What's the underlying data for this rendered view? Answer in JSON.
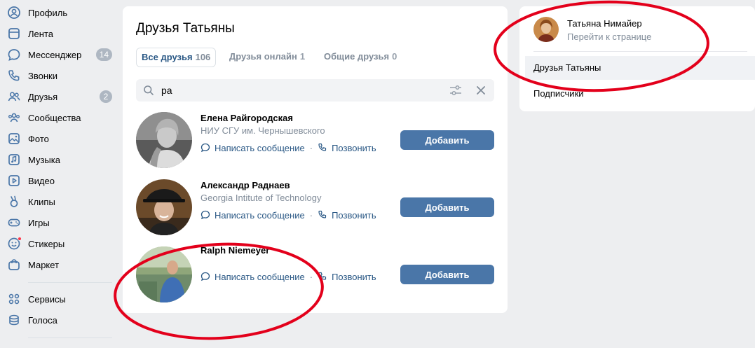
{
  "nav": {
    "items": [
      {
        "label": "Профиль",
        "icon": "profile-icon"
      },
      {
        "label": "Лента",
        "icon": "feed-icon"
      },
      {
        "label": "Мессенджер",
        "icon": "messenger-icon",
        "badge": "14"
      },
      {
        "label": "Звонки",
        "icon": "phone-icon"
      },
      {
        "label": "Друзья",
        "icon": "friends-icon",
        "badge": "2"
      },
      {
        "label": "Сообщества",
        "icon": "communities-icon"
      },
      {
        "label": "Фото",
        "icon": "photo-icon"
      },
      {
        "label": "Музыка",
        "icon": "music-icon"
      },
      {
        "label": "Видео",
        "icon": "video-icon"
      },
      {
        "label": "Клипы",
        "icon": "clips-icon"
      },
      {
        "label": "Игры",
        "icon": "games-icon"
      },
      {
        "label": "Стикеры",
        "icon": "stickers-icon"
      },
      {
        "label": "Маркет",
        "icon": "market-icon"
      },
      {
        "label": "Сервисы",
        "icon": "services-icon"
      },
      {
        "label": "Голоса",
        "icon": "votes-icon"
      }
    ]
  },
  "main": {
    "title": "Друзья Татьяны",
    "tabs": [
      {
        "label": "Все друзья",
        "count": "106",
        "active": true
      },
      {
        "label": "Друзья онлайн",
        "count": "1",
        "active": false
      },
      {
        "label": "Общие друзья",
        "count": "0",
        "active": false
      }
    ],
    "search": {
      "value": "ра"
    },
    "friends": [
      {
        "name": "Елена Райгородская",
        "subtitle": "НИУ СГУ им. Чернышевского",
        "message_label": "Написать сообщение",
        "call_label": "Позвонить",
        "add_label": "Добавить"
      },
      {
        "name": "Александр Раднаев",
        "subtitle": "Georgia Intitute of Technology",
        "message_label": "Написать сообщение",
        "call_label": "Позвонить",
        "add_label": "Добавить"
      },
      {
        "name": "Ralph Niemeyer",
        "subtitle": "",
        "message_label": "Написать сообщение",
        "call_label": "Позвонить",
        "add_label": "Добавить"
      }
    ],
    "separator": "·"
  },
  "side": {
    "user_name": "Татьяна Нимайер",
    "goto_label": "Перейти к странице",
    "menu": [
      {
        "label": "Друзья Татьяны",
        "active": true
      },
      {
        "label": "Подписчики",
        "active": false
      }
    ]
  },
  "colors": {
    "accent": "#2a5885",
    "button": "#4a76a8",
    "annotation": "#e3001b",
    "badge": "#aeb7c2",
    "background": "#edeef0"
  }
}
